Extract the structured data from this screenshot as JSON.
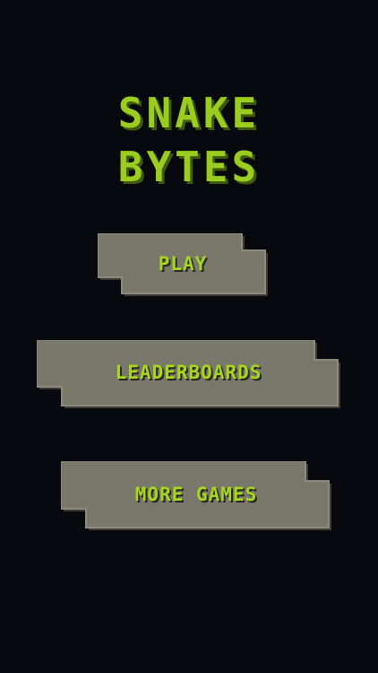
{
  "title": {
    "line1": "SNAKE",
    "line2": "BYTES"
  },
  "menu": {
    "play_label": "PLAY",
    "leaderboards_label": "LEADERBOARDS",
    "more_games_label": "MORE GAMES"
  },
  "colors": {
    "background": "#08080f",
    "title_green": "#9acd1f",
    "label_green": "#a6d61e",
    "button_face": "#7a776b",
    "button_shadow": "#4a483f"
  }
}
